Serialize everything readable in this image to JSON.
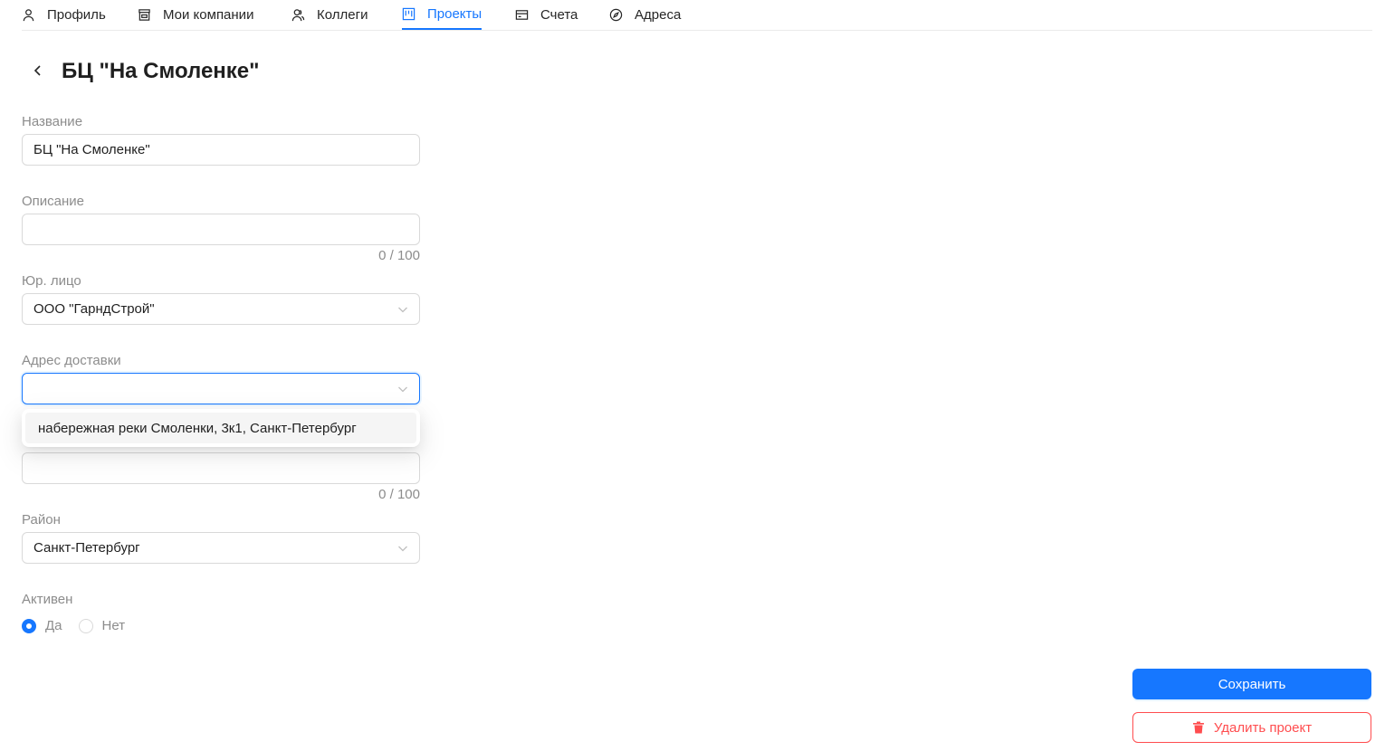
{
  "nav": {
    "tabs": [
      {
        "label": "Профиль",
        "icon": "user-icon"
      },
      {
        "label": "Мои компании",
        "icon": "shop-icon"
      },
      {
        "label": "Коллеги",
        "icon": "team-icon"
      },
      {
        "label": "Проекты",
        "icon": "project-icon",
        "active": true
      },
      {
        "label": "Счета",
        "icon": "credit-card-icon"
      },
      {
        "label": "Адреса",
        "icon": "compass-icon"
      }
    ]
  },
  "page": {
    "title": "БЦ \"На Смоленке\""
  },
  "form": {
    "name": {
      "label": "Название",
      "value": "БЦ \"На Смоленке\""
    },
    "description": {
      "label": "Описание",
      "value": "",
      "counter": "0 / 100"
    },
    "legal_entity": {
      "label": "Юр. лицо",
      "value": "ООО \"ГарндСтрой\""
    },
    "delivery_address": {
      "label": "Адрес доставки",
      "value": "",
      "options": [
        "набережная реки Смоленки, 3к1, Санкт-Петербург"
      ]
    },
    "hidden_field": {
      "value": "",
      "counter": "0 / 100"
    },
    "district": {
      "label": "Район",
      "value": "Санкт-Петербург"
    },
    "active": {
      "label": "Активен",
      "options": [
        "Да",
        "Нет"
      ],
      "selected": "Да"
    }
  },
  "actions": {
    "save_label": "Сохранить",
    "delete_label": "Удалить проект"
  },
  "colors": {
    "accent": "#1677ff",
    "danger": "#ff4d4f",
    "muted_text": "#8c8c8c",
    "border": "#d9d9d9"
  }
}
